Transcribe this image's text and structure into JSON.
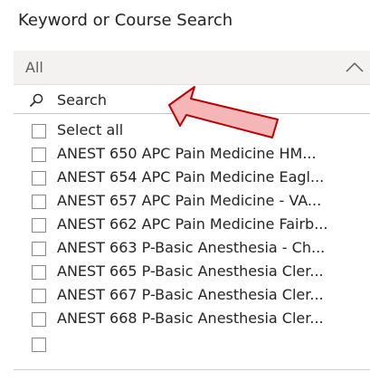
{
  "slicer": {
    "title": "Keyword or Course Search",
    "selected_value": "All",
    "search_placeholder": "Search",
    "items": [
      {
        "label": "Select all"
      },
      {
        "label": "ANEST 650 APC Pain Medicine HM..."
      },
      {
        "label": "ANEST 654 APC Pain Medicine Eagl..."
      },
      {
        "label": "ANEST 657 APC Pain Medicine - VA..."
      },
      {
        "label": "ANEST 662 APC Pain Medicine Fairb..."
      },
      {
        "label": "ANEST 663 P-Basic Anesthesia - Ch..."
      },
      {
        "label": "ANEST 665 P-Basic Anesthesia Cler..."
      },
      {
        "label": "ANEST 667 P-Basic Anesthesia Cler..."
      },
      {
        "label": "ANEST 668 P-Basic Anesthesia Cler..."
      }
    ]
  },
  "colors": {
    "arrow_fill": "#f4b6b6",
    "arrow_stroke": "#c00000"
  },
  "icons": {
    "search": "search-icon",
    "chevron": "chevron-up-icon",
    "annotation": "red-arrow-icon"
  }
}
